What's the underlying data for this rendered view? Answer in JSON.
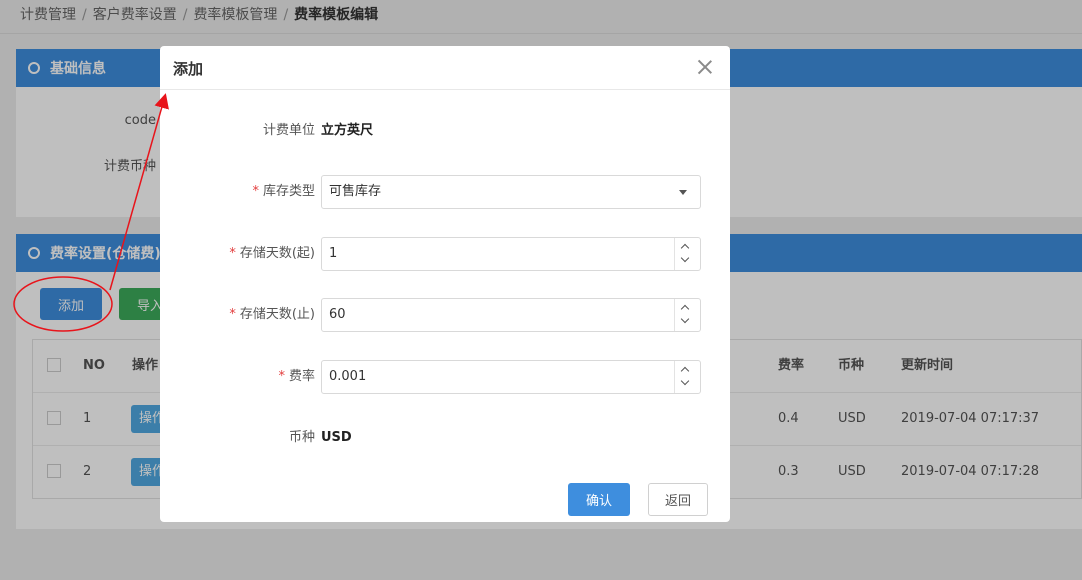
{
  "breadcrumb": [
    "计费管理",
    "客户费率设置",
    "费率模板管理",
    "费率模板编辑"
  ],
  "basic_panel": {
    "title": "基础信息",
    "labels": [
      "code",
      "计费币种"
    ]
  },
  "rate_panel": {
    "title": "费率设置(仓储费)",
    "add_label": "添加",
    "import_label": "导入",
    "table": {
      "headers": {
        "no": "NO",
        "op": "操作",
        "rate": "费率",
        "currency": "币种",
        "updated": "更新时间"
      },
      "rows": [
        {
          "no": "1",
          "op": "操作",
          "rate": "0.4",
          "currency": "USD",
          "updated": "2019-07-04 07:17:37"
        },
        {
          "no": "2",
          "op": "操作",
          "rate": "0.3",
          "currency": "USD",
          "updated": "2019-07-04 07:17:28"
        }
      ]
    }
  },
  "modal": {
    "title": "添加",
    "fields": {
      "unit": {
        "label": "计费单位",
        "value": "立方英尺"
      },
      "stock_type": {
        "label": "库存类型",
        "value": "可售库存"
      },
      "days_start": {
        "label": "存储天数(起)",
        "value": "1"
      },
      "days_end": {
        "label": "存储天数(止)",
        "value": "60"
      },
      "rate": {
        "label": "费率",
        "value": "0.001"
      },
      "currency": {
        "label": "币种",
        "value": "USD"
      }
    },
    "required_mark": "*",
    "confirm_label": "确认",
    "back_label": "返回"
  },
  "colors": {
    "primary": "#3e8ede",
    "success": "#3dab5b",
    "annotation": "#e8141b",
    "required": "#e23c3c"
  }
}
